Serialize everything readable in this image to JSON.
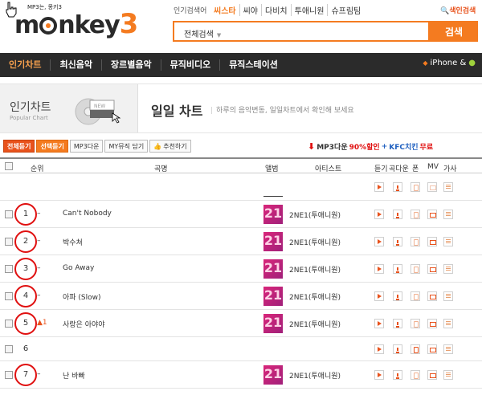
{
  "header": {
    "logo_small": "MP3는, 몽키3",
    "logo_main": "m nkey",
    "logo_num": "3",
    "keyword_label": "인기검색어",
    "keywords": [
      "씨스타",
      "씨야",
      "다비치",
      "투애니원",
      "슈프림팀"
    ],
    "color_search": "색인검색",
    "search_category": "전체검색",
    "search_placeholder": "",
    "search_button": "검색"
  },
  "nav": {
    "items": [
      "인기차트",
      "최신음악",
      "장르별음악",
      "뮤직비디오",
      "뮤직스테이션"
    ],
    "active_index": 0,
    "right_text": "iPhone &"
  },
  "banner": {
    "title": "인기차트",
    "subtitle": "Popular Chart",
    "icon_tag": "NEW",
    "page_title": "일일 차트",
    "description": "하루의 음악변동, 일일차트에서 확인해 보세요"
  },
  "actions": {
    "buttons": [
      "전체듣기",
      "선택듣기",
      "MP3다운",
      "MY뮤직 담기",
      "추천하기"
    ],
    "promo_prefix": "MP3다운",
    "promo_pct": "90%할인",
    "promo_plus": "+",
    "promo_kfc": "KFC치킨",
    "promo_free": "무료"
  },
  "table": {
    "headers": {
      "rank": "순위",
      "title": "곡명",
      "album": "앨범",
      "artist": "아티스트",
      "listen": "듣기",
      "download": "곡다운",
      "phone": "폰",
      "mv": "MV",
      "lyrics": "가사"
    },
    "rows": [
      {
        "rank": "1",
        "change": "–",
        "title": "Can't Nobody",
        "album_text": "21",
        "artist": "2NE1(투애니원)",
        "circled": true
      },
      {
        "rank": "2",
        "change": "–",
        "title": "박수쳐",
        "album_text": "21",
        "artist": "2NE1(투애니원)",
        "circled": true
      },
      {
        "rank": "3",
        "change": "–",
        "title": "Go Away",
        "album_text": "21",
        "artist": "2NE1(투애니원)",
        "circled": true
      },
      {
        "rank": "4",
        "change": "–",
        "title": "아파 (Slow)",
        "album_text": "21",
        "artist": "2NE1(투애니원)",
        "circled": true
      },
      {
        "rank": "5",
        "change": "▲1",
        "title": "사랑은 아야야",
        "album_text": "21",
        "artist": "2NE1(투애니원)",
        "circled": true
      },
      {
        "rank": "6",
        "change": "",
        "title": "",
        "album_text": "",
        "artist": "",
        "circled": false
      },
      {
        "rank": "7",
        "change": "–",
        "title": "난 바빠",
        "album_text": "21",
        "artist": "2NE1(투애니원)",
        "circled": true
      }
    ]
  }
}
